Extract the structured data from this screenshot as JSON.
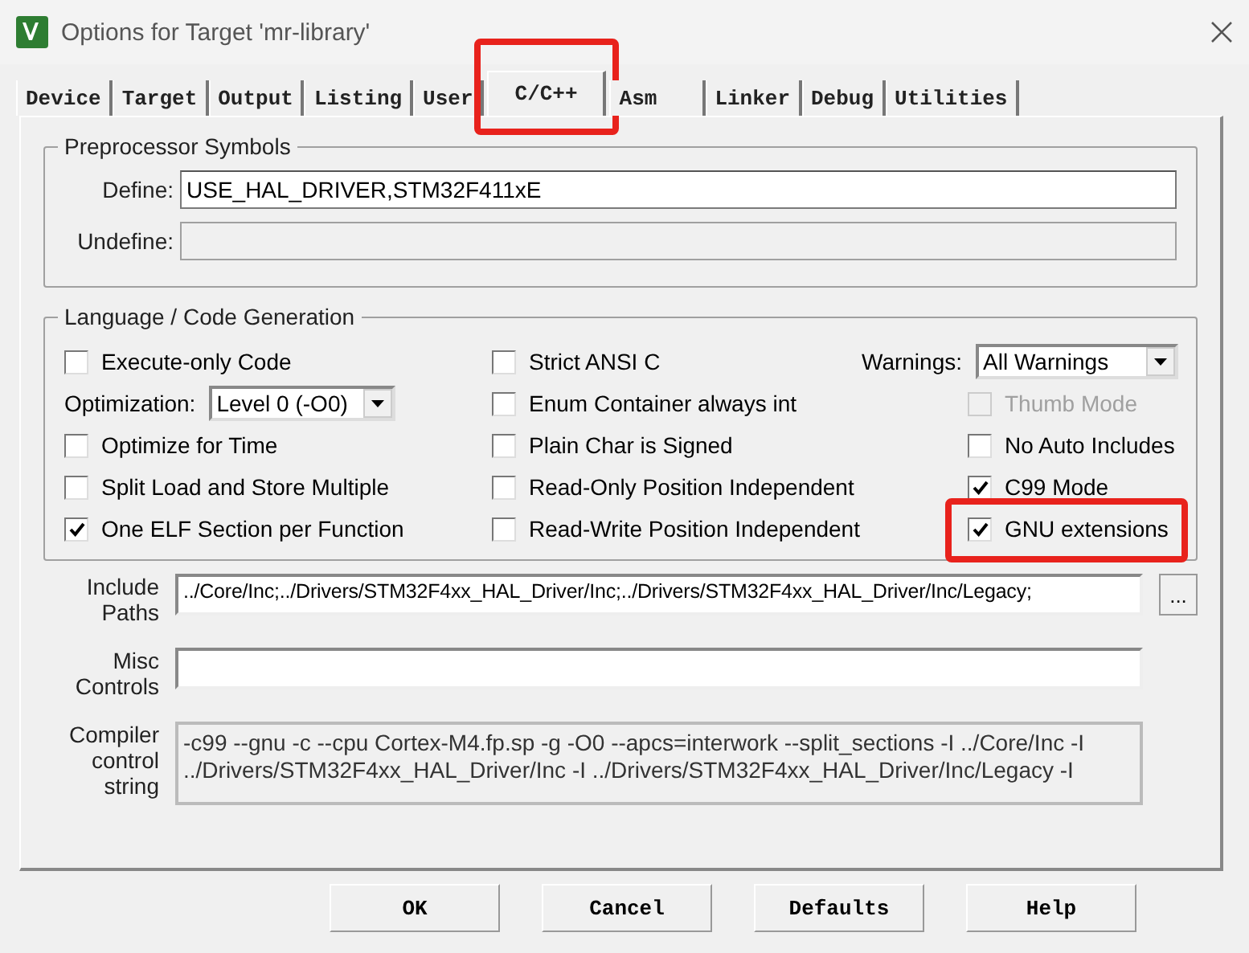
{
  "window": {
    "title": "Options for Target 'mr-library'"
  },
  "tabs": [
    {
      "label": "Device",
      "selected": false,
      "highlighted": false
    },
    {
      "label": "Target",
      "selected": false,
      "highlighted": false
    },
    {
      "label": "Output",
      "selected": false,
      "highlighted": false
    },
    {
      "label": "Listing",
      "selected": false,
      "highlighted": false
    },
    {
      "label": "User",
      "selected": false,
      "highlighted": false
    },
    {
      "label": "C/C++",
      "selected": true,
      "highlighted": true
    },
    {
      "label": "Asm",
      "selected": false,
      "highlighted": false
    },
    {
      "label": "Linker",
      "selected": false,
      "highlighted": false
    },
    {
      "label": "Debug",
      "selected": false,
      "highlighted": false
    },
    {
      "label": "Utilities",
      "selected": false,
      "highlighted": false
    }
  ],
  "preprocessor": {
    "title": "Preprocessor Symbols",
    "fields": [
      {
        "label": "Define:",
        "value": "USE_HAL_DRIVER,STM32F411xE",
        "disabled": false
      },
      {
        "label": "Undefine:",
        "disabled": true
      }
    ]
  },
  "code_generation": {
    "title": "Language / Code Generation",
    "columns": [
      [
        {
          "kind": "checkbox",
          "label": "Execute-only Code",
          "checked": false,
          "disabled": false,
          "highlighted": false
        },
        {
          "kind": "dropdown",
          "label": "Optimization:",
          "value": "Level 0 (-O0)"
        },
        {
          "kind": "checkbox",
          "label": "Optimize for Time",
          "checked": false,
          "disabled": false,
          "highlighted": false
        },
        {
          "kind": "checkbox",
          "label": "Split Load and Store Multiple",
          "checked": false,
          "disabled": false,
          "highlighted": false
        },
        {
          "kind": "checkbox",
          "label": "One ELF Section per Function",
          "checked": true,
          "disabled": false,
          "highlighted": false
        }
      ],
      [
        {
          "kind": "checkbox",
          "label": "Strict ANSI C",
          "checked": false,
          "disabled": false,
          "highlighted": false
        },
        {
          "kind": "checkbox",
          "label": "Enum Container always int",
          "checked": false,
          "disabled": false,
          "highlighted": false
        },
        {
          "kind": "checkbox",
          "label": "Plain Char is Signed",
          "checked": false,
          "disabled": false,
          "highlighted": false
        },
        {
          "kind": "checkbox",
          "label": "Read-Only Position Independent",
          "checked": false,
          "disabled": false,
          "highlighted": false
        },
        {
          "kind": "checkbox",
          "label": "Read-Write Position Independent",
          "checked": false,
          "disabled": false,
          "highlighted": false
        }
      ],
      [
        {
          "kind": "dropdown",
          "label": "Warnings:",
          "value": "All Warnings"
        },
        {
          "kind": "checkbox",
          "label": "Thumb Mode",
          "checked": false,
          "disabled": true,
          "highlighted": false
        },
        {
          "kind": "checkbox",
          "label": "No Auto Includes",
          "checked": false,
          "disabled": false,
          "highlighted": false
        },
        {
          "kind": "checkbox",
          "label": "C99 Mode",
          "checked": true,
          "disabled": false,
          "highlighted": false
        },
        {
          "kind": "checkbox",
          "label": "GNU extensions",
          "checked": true,
          "disabled": false,
          "highlighted": true
        }
      ]
    ]
  },
  "include_paths": {
    "label": "Include Paths",
    "value": "../Core/Inc;../Drivers/STM32F4xx_HAL_Driver/Inc;../Drivers/STM32F4xx_HAL_Driver/Inc/Legacy;",
    "button": "..."
  },
  "misc_controls": {
    "label": "Misc Controls"
  },
  "compiler_string": {
    "label": "Compiler control string",
    "value": "-c99 --gnu -c --cpu Cortex-M4.fp.sp -g -O0 --apcs=interwork --split_sections -I ../Core/Inc -I ../Drivers/STM32F4xx_HAL_Driver/Inc -I ../Drivers/STM32F4xx_HAL_Driver/Inc/Legacy -I"
  },
  "buttons": [
    "OK",
    "Cancel",
    "Defaults",
    "Help"
  ]
}
